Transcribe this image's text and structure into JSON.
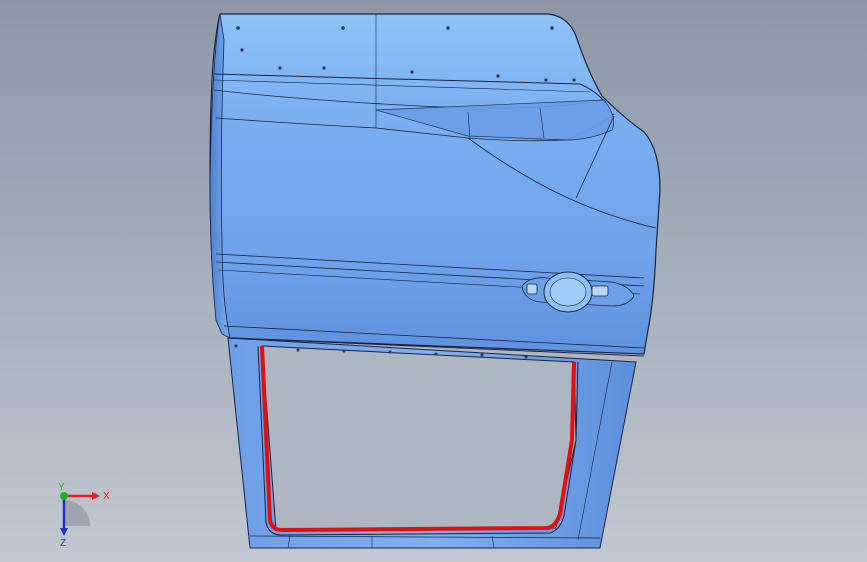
{
  "viewport": {
    "background_top": "#8d97a6",
    "background_bottom": "#c2c8d1"
  },
  "model": {
    "part_color": "#8fc0f5",
    "part_shade": "#5c8fd9",
    "edge_color": "#1a2440",
    "seal_color": "#e01010"
  },
  "triad": {
    "x_label": "X",
    "y_label": "Y",
    "z_label": "Z",
    "x_color": "#e02020",
    "y_color": "#20b020",
    "z_color": "#2030c0"
  }
}
